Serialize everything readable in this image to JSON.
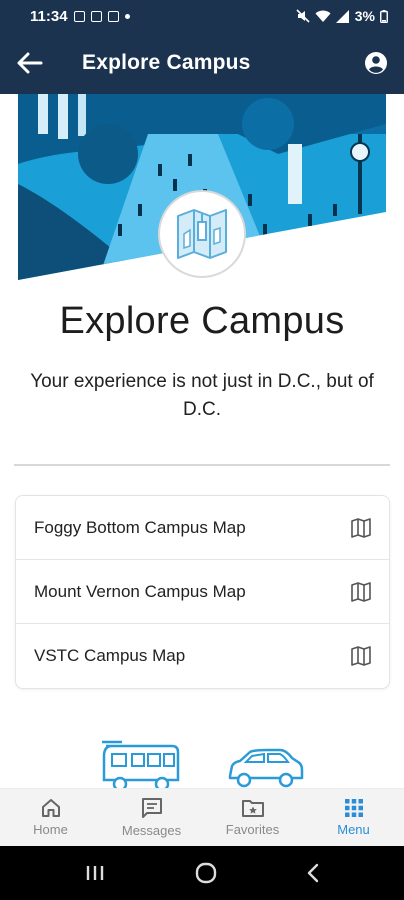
{
  "status_bar": {
    "time": "11:34",
    "battery": "3%"
  },
  "app_bar": {
    "title": "Explore Campus",
    "back_icon": "arrow-left-icon",
    "profile_icon": "account-circle-icon"
  },
  "hero": {
    "badge_icon": "campus-map-icon"
  },
  "main": {
    "title": "Explore Campus",
    "tagline": "Your experience is not just in D.C., but of D.C."
  },
  "map_list": [
    {
      "label": "Foggy Bottom Campus Map",
      "icon": "map-icon"
    },
    {
      "label": "Mount Vernon Campus Map",
      "icon": "map-icon"
    },
    {
      "label": "VSTC Campus Map",
      "icon": "map-icon"
    }
  ],
  "bottom_nav": [
    {
      "label": "Home",
      "icon": "home-icon",
      "active": false
    },
    {
      "label": "Messages",
      "icon": "messages-icon",
      "active": false
    },
    {
      "label": "Favorites",
      "icon": "favorites-folder-icon",
      "active": false
    },
    {
      "label": "Menu",
      "icon": "grid-menu-icon",
      "active": true
    }
  ],
  "colors": {
    "header_bg": "#1c3350",
    "accent": "#2a8ed6",
    "hero_tint": "#1a9fd6"
  }
}
